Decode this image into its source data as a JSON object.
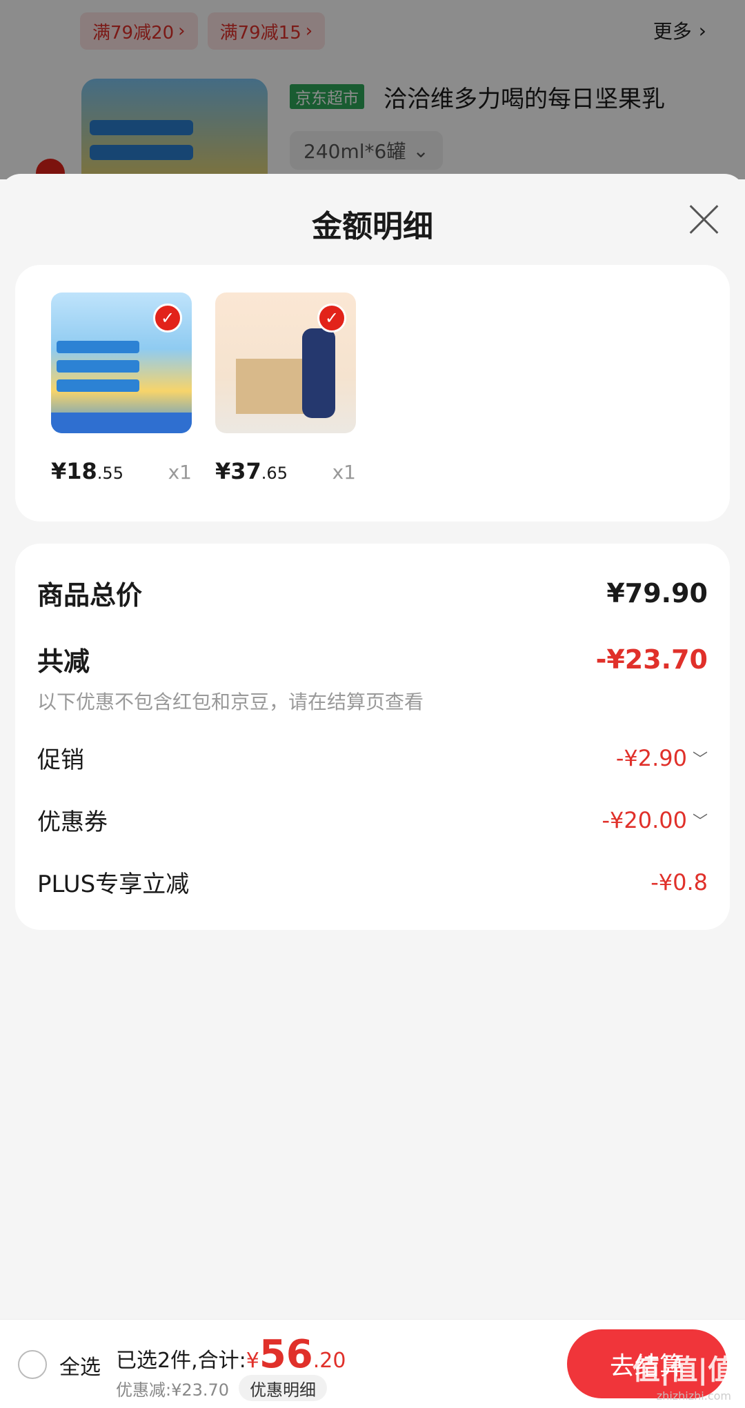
{
  "background": {
    "promos": [
      "满79减20",
      "满79减15"
    ],
    "more_label": "更多",
    "store_badge": "京东超市",
    "product_title": "洽洽维多力喝的每日坚果乳",
    "spec": "240ml*6罐"
  },
  "sheet": {
    "title": "金额明细",
    "products": [
      {
        "price_int": "¥18",
        "price_dec": ".55",
        "qty": "x1"
      },
      {
        "price_int": "¥37",
        "price_dec": ".65",
        "qty": "x1"
      }
    ],
    "summary": {
      "total_label": "商品总价",
      "total_value": "¥79.90",
      "reduce_label": "共减",
      "reduce_value": "-¥23.70",
      "note": "以下优惠不包含红包和京豆，请在结算页查看",
      "items": [
        {
          "label": "促销",
          "value": "-¥2.90"
        },
        {
          "label": "优惠券",
          "value": "-¥20.00"
        },
        {
          "label": "PLUS专享立减",
          "value": "-¥0.8"
        }
      ]
    }
  },
  "bottom_bar": {
    "select_all": "全选",
    "selected_label": "已选2件,合计:",
    "yen": "¥",
    "total_int": "56",
    "total_dec": ".20",
    "discount": "优惠减:¥23.70",
    "detail_button": "优惠明细",
    "checkout": "去结算",
    "watermark": "值|值|值",
    "watermark_sub": "zhizhizhi.com"
  },
  "colors": {
    "accent": "#e0302a",
    "checkout": "#f0353a",
    "store_green": "#2fa85a"
  }
}
